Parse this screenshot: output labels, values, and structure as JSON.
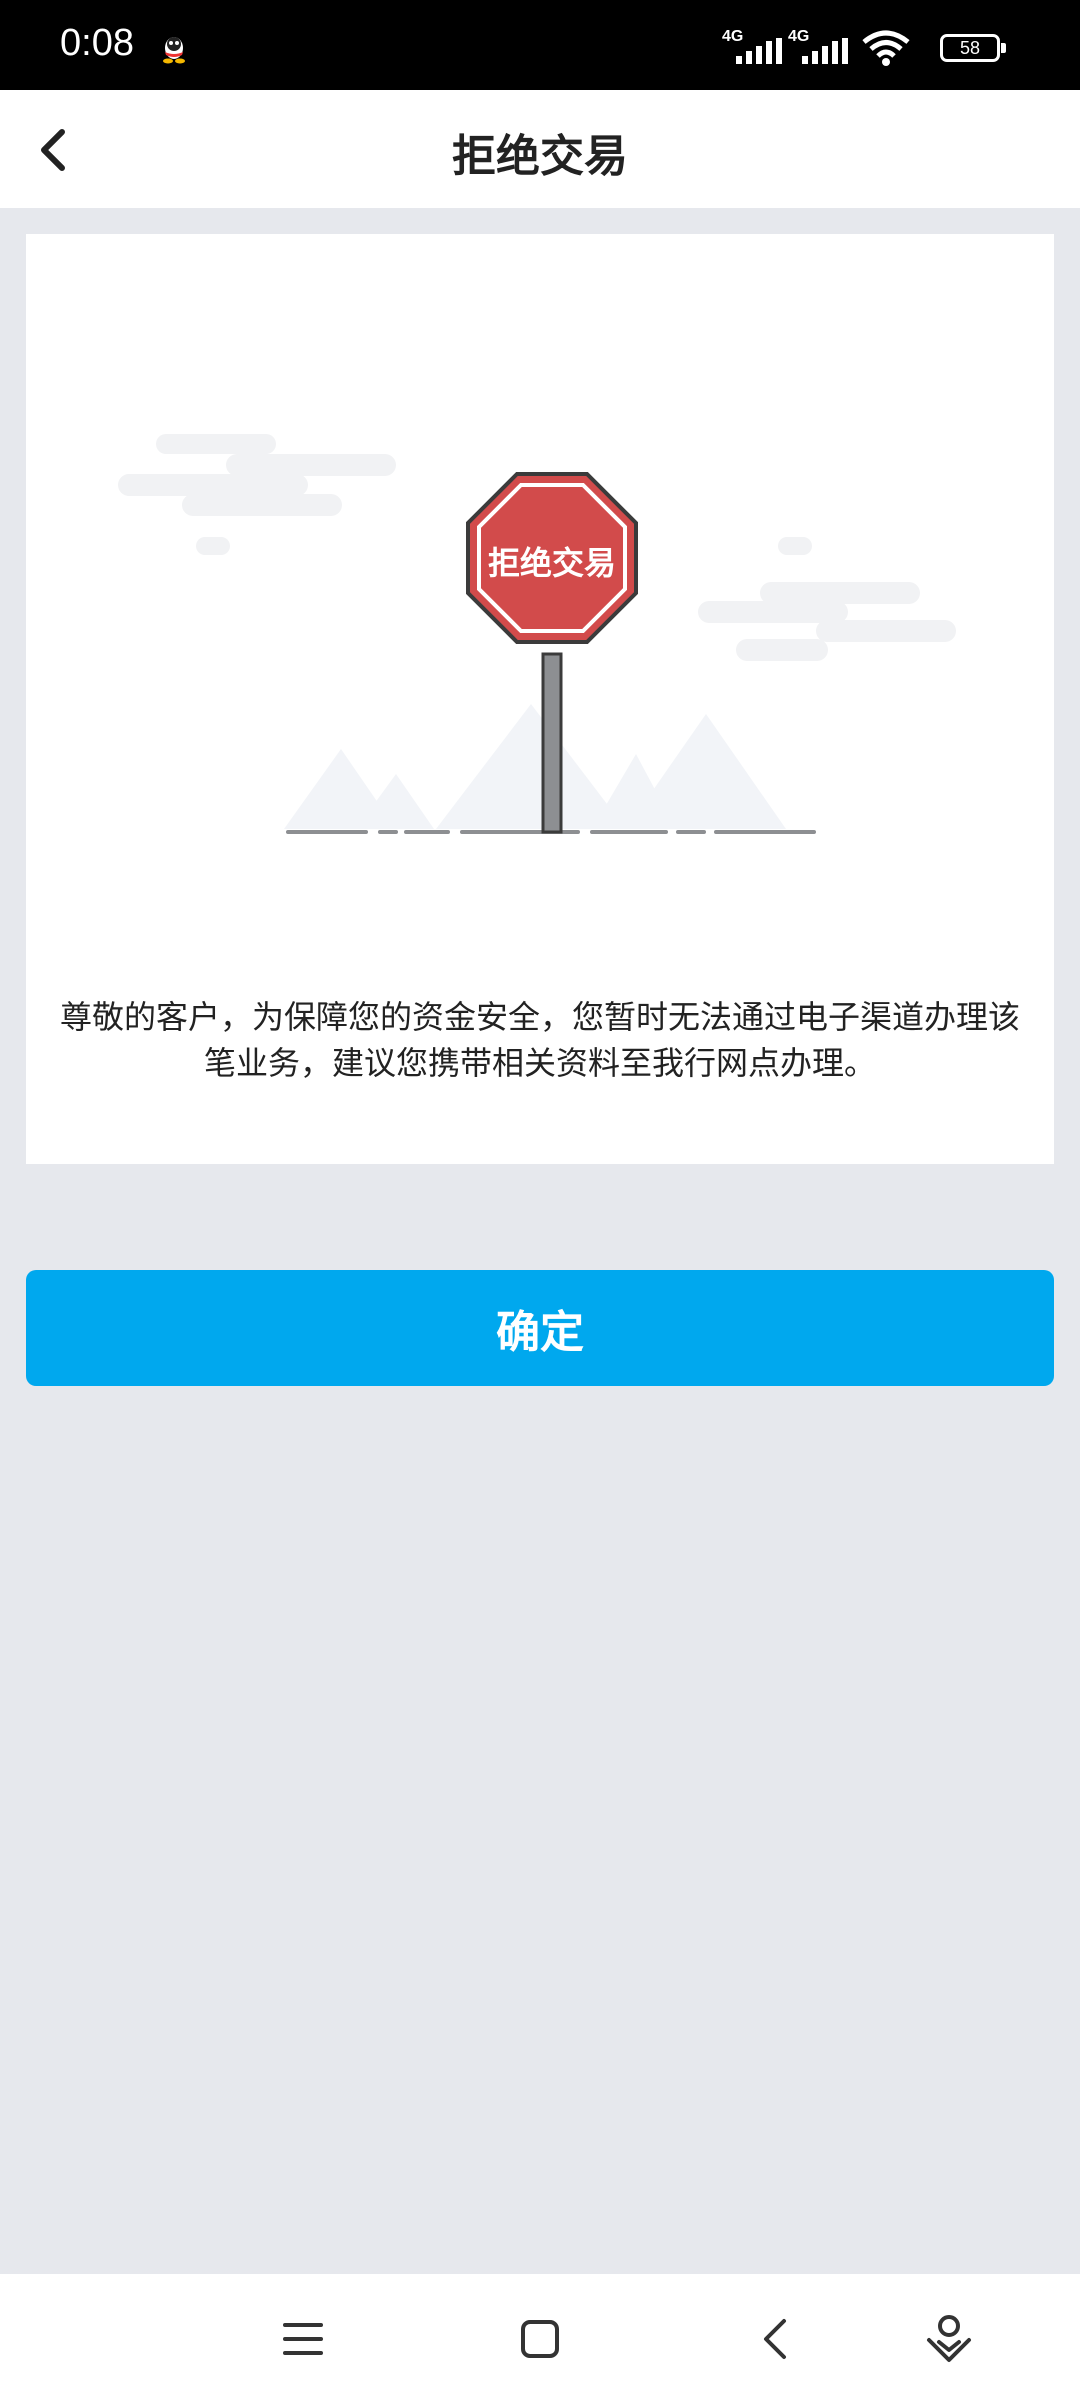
{
  "status_bar": {
    "time": "0:08",
    "network": [
      "4G",
      "4G"
    ],
    "battery": "58",
    "icons": [
      "qq-icon",
      "signal-icon",
      "wifi-icon",
      "battery-icon"
    ]
  },
  "header": {
    "title": "拒绝交易",
    "back_icon": "chevron-left-icon"
  },
  "illustration": {
    "sign_text": "拒绝交易",
    "sign_color": "#d24b4b"
  },
  "message": "尊敬的客户，为保障您的资金安全，您暂时无法通过电子渠道办理该笔业务，建议您携带相关资料至我行网点办理。",
  "confirm_label": "确定",
  "colors": {
    "accent": "#00a8ee",
    "background": "#e6e8ed"
  },
  "nav_bar": {
    "icons": [
      "menu-icon",
      "home-icon",
      "back-icon",
      "assistant-icon"
    ]
  }
}
